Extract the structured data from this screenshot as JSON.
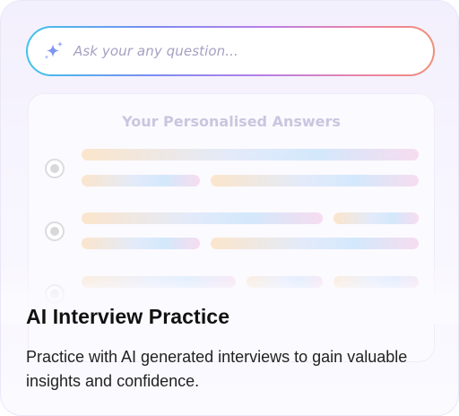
{
  "search": {
    "placeholder": "Ask your any question...",
    "icon": "sparkle-icon"
  },
  "answers_panel": {
    "title": "Your Personalised Answers",
    "options": [
      {
        "selected": true
      },
      {
        "selected": true
      },
      {
        "selected": true
      }
    ]
  },
  "card": {
    "title": "AI Interview Practice",
    "description": "Practice with AI generated interviews to gain valuable insights and confidence."
  },
  "colors": {
    "gradient_start": "#3fc4ea",
    "gradient_mid": "#b77ee8",
    "gradient_end": "#f08e78",
    "placeholder_text": "#a5a0c2",
    "panel_title": "#c9c6e0"
  }
}
